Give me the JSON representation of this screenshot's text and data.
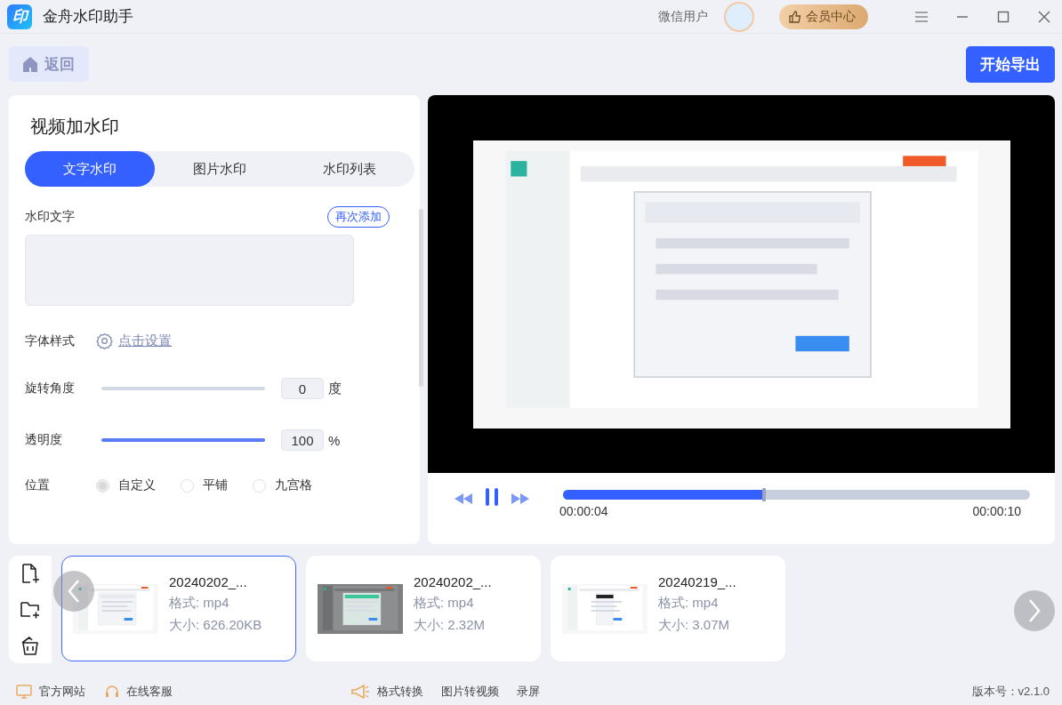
{
  "app": {
    "logo_text": "印",
    "title": "金舟水印助手",
    "user_name": "微信用户",
    "vip_button": "会员中心"
  },
  "toolbar": {
    "back_button": "返回",
    "export_button": "开始导出"
  },
  "panel": {
    "title": "视频加水印",
    "tabs": [
      {
        "label": "文字水印",
        "selected": true
      },
      {
        "label": "图片水印",
        "selected": false
      },
      {
        "label": "水印列表",
        "selected": false
      }
    ],
    "watermark_text": {
      "label": "水印文字",
      "add_button": "再次添加"
    },
    "font_style": {
      "label": "字体样式",
      "link": "点击设置"
    },
    "sliders": [
      {
        "label": "旋转角度",
        "level": 0,
        "value": "0",
        "unit": "度"
      },
      {
        "label": "透明度",
        "level": 1,
        "value": "100",
        "unit": "%"
      }
    ],
    "position": {
      "label": "位置",
      "options": [
        {
          "label": "自定义",
          "selected": true,
          "disabled": true
        },
        {
          "label": "平铺",
          "selected": false,
          "disabled": false
        },
        {
          "label": "九宫格",
          "selected": false,
          "disabled": false
        }
      ]
    }
  },
  "player": {
    "playing": true,
    "progress": {
      "level": 0.43
    },
    "current_time": "00:00:04",
    "total_time": "00:00:10"
  },
  "files": [
    {
      "name": "20240202_...",
      "format": "格式: mp4",
      "size": "大小: 626.20KB",
      "selected": true
    },
    {
      "name": "20240202_...",
      "format": "格式: mp4",
      "size": "大小: 2.32M",
      "selected": false
    },
    {
      "name": "20240219_...",
      "format": "格式: mp4",
      "size": "大小: 3.07M",
      "selected": false
    }
  ],
  "footer": {
    "links": [
      {
        "label": "官方网站",
        "kind": "website"
      },
      {
        "label": "在线客服",
        "kind": "support"
      }
    ],
    "tools": [
      {
        "label": "格式转换",
        "kind": "promo"
      },
      {
        "label": "图片转视频",
        "kind": "plain"
      },
      {
        "label": "录屏",
        "kind": "plain"
      }
    ],
    "version": "版本号：v2.1.0"
  }
}
